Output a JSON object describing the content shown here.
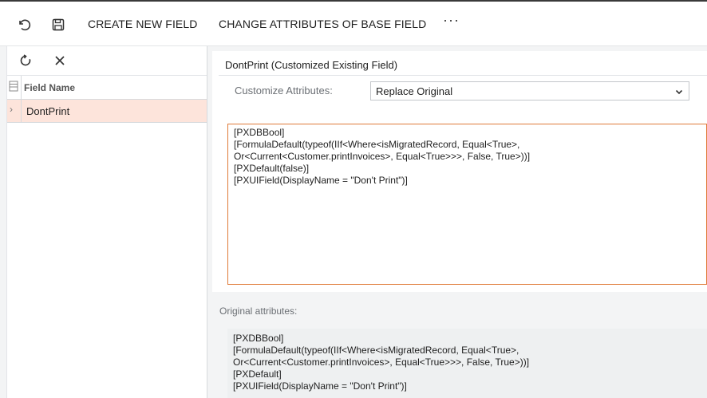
{
  "toolbar": {
    "undo_icon": "undo-icon",
    "save_icon": "save-icon",
    "create_field": "CREATE NEW FIELD",
    "change_attributes": "CHANGE ATTRIBUTES OF BASE FIELD",
    "more": "···"
  },
  "left_pane": {
    "refresh_icon": "refresh-icon",
    "close_icon": "close-icon",
    "column_header": "Field Name",
    "rows": [
      {
        "name": "DontPrint"
      }
    ]
  },
  "detail": {
    "title": "DontPrint (Customized Existing Field)",
    "customize_label": "Customize Attributes:",
    "customize_value": "Replace Original",
    "custom_attributes": [
      "[PXDBBool]",
      "[FormulaDefault(typeof(IIf<Where<isMigratedRecord, Equal<True>,",
      "Or<Current<Customer.printInvoices>, Equal<True>>>, False, True>))]",
      "[PXDefault(false)]",
      "[PXUIField(DisplayName = \"Don't Print\")]"
    ],
    "original_label": "Original attributes:",
    "original_attributes": [
      "[PXDBBool]",
      "[FormulaDefault(typeof(IIf<Where<isMigratedRecord, Equal<True>,",
      "Or<Current<Customer.printInvoices>, Equal<True>>>, False, True>))]",
      "[PXDefault]",
      "[PXUIField(DisplayName = \"Don't Print\")]"
    ]
  },
  "colors": {
    "selected_row": "#fde4db",
    "focus_border": "#e07b39"
  }
}
